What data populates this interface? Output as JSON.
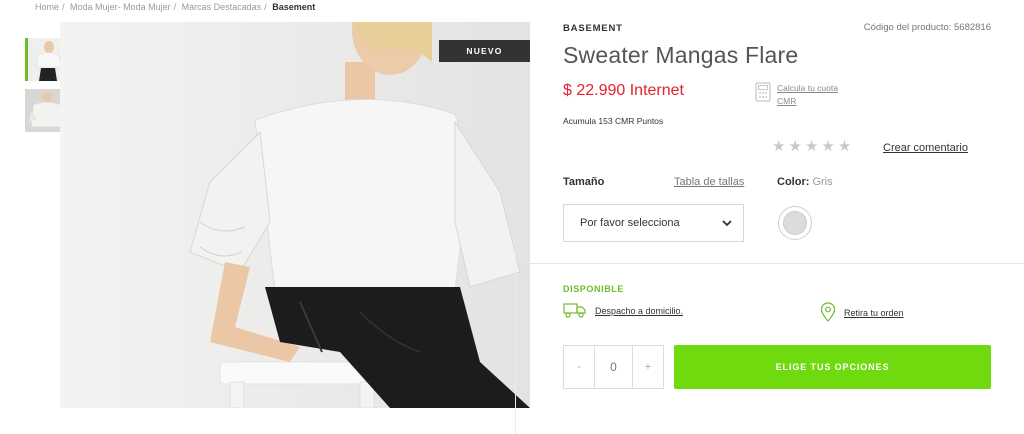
{
  "breadcrumb": [
    "Home",
    "Moda Mujer- Moda Mujer",
    "Marcas Destacadas",
    "Basement"
  ],
  "product": {
    "badge": "NUEVO",
    "brand": "BASEMENT",
    "code": "Código del producto: 5682816",
    "title": "Sweater Mangas Flare",
    "price": "$ 22.990 Internet",
    "installment_link": "Calcula tu cuota CMR",
    "points": "Acumula 153 CMR Puntos",
    "rating_stars": 5,
    "rating_value": 0,
    "comment_link": "Crear comentario"
  },
  "options": {
    "size_label": "Tamaño",
    "size_table_link": "Tabla de tallas",
    "color_label": "Color:",
    "color_value": "Gris",
    "size_select_value": "Por favor selecciona",
    "swatch_color": "#dcdcdc"
  },
  "availability": {
    "status": "DISPONIBLE",
    "delivery": "Despacho a domicilio.",
    "pickup": "Retira tu orden"
  },
  "purchase": {
    "minus": "-",
    "quantity": "0",
    "plus": "+",
    "cta": "ELIGE TUS OPCIONES"
  },
  "colors": {
    "accent_green": "#6fda0d",
    "available_green": "#6dbd28",
    "price_red": "#e4202f"
  }
}
